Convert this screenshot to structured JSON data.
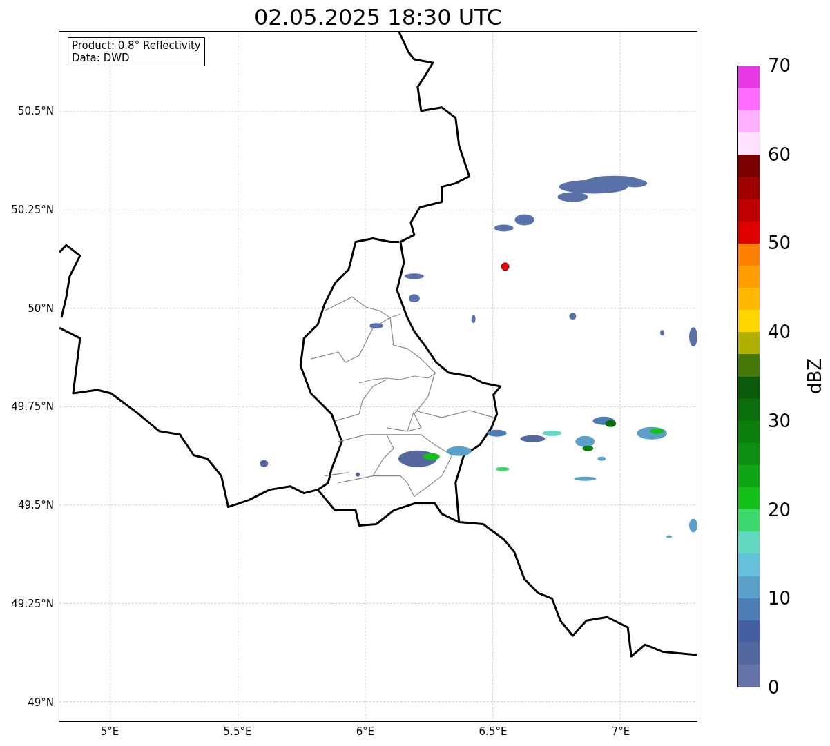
{
  "title": "02.05.2025 18:30 UTC",
  "info_box": {
    "lines": [
      "Product: 0.8° Reflectivity",
      "Data: DWD"
    ]
  },
  "map": {
    "yticks": [
      "50.5°N",
      "50.25°N",
      "50°N",
      "49.75°N",
      "49.5°N",
      "49.25°N",
      "49°N"
    ],
    "xticks": [
      "5°E",
      "5.5°E",
      "6°E",
      "6.5°E",
      "7°E"
    ]
  },
  "colorbar": {
    "label": "dBZ",
    "ticks": [
      "70",
      "60",
      "50",
      "40",
      "30",
      "20",
      "10",
      "0"
    ],
    "segments": [
      {
        "color": "#e838e8"
      },
      {
        "color": "#ff6cff"
      },
      {
        "color": "#ffb0ff"
      },
      {
        "color": "#ffe0ff"
      },
      {
        "color": "#7a0000"
      },
      {
        "color": "#a00000"
      },
      {
        "color": "#c00000"
      },
      {
        "color": "#e00000"
      },
      {
        "color": "#ff7f00"
      },
      {
        "color": "#ff9c00"
      },
      {
        "color": "#ffb900"
      },
      {
        "color": "#ffd700"
      },
      {
        "color": "#b0b000"
      },
      {
        "color": "#457a0a"
      },
      {
        "color": "#0a5c0a"
      },
      {
        "color": "#0a6e0a"
      },
      {
        "color": "#0a800a"
      },
      {
        "color": "#0c8f12"
      },
      {
        "color": "#0fa514"
      },
      {
        "color": "#12c018"
      },
      {
        "color": "#3dd86e"
      },
      {
        "color": "#62d8c0"
      },
      {
        "color": "#65c0dc"
      },
      {
        "color": "#5aa0c8"
      },
      {
        "color": "#4c7db4"
      },
      {
        "color": "#4560a0"
      },
      {
        "color": "#5468a0"
      },
      {
        "color": "#6673a8"
      }
    ]
  }
}
